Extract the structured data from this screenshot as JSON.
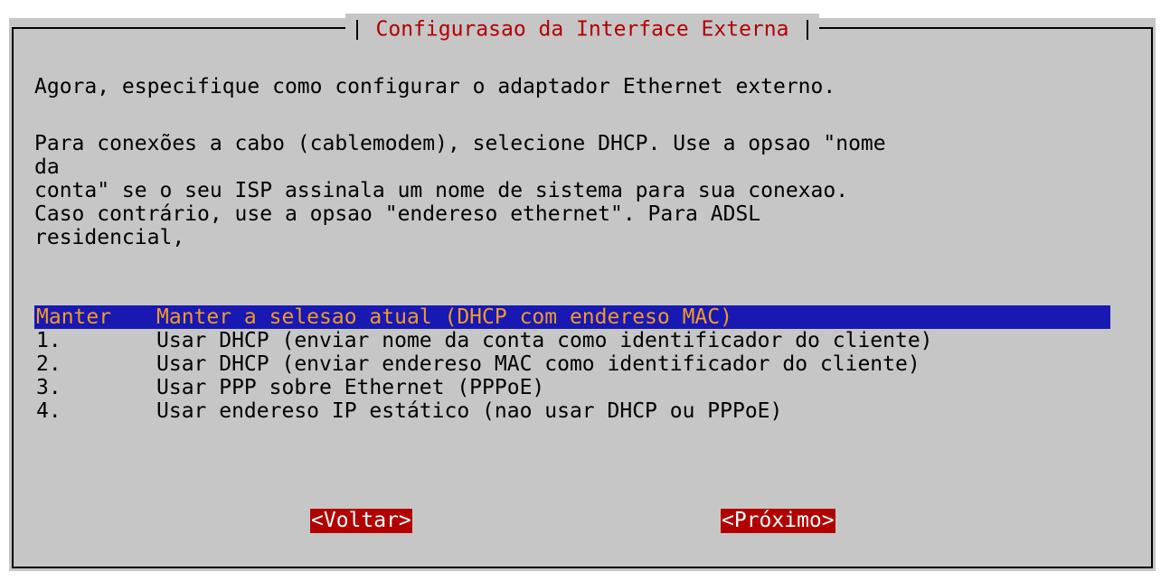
{
  "dialog": {
    "title": "Configurasao da Interface Externa",
    "intro": "Agora, especifique como configurar o adaptador Ethernet externo.",
    "paragraph_lines": [
      "Para conexões a cabo (cablemodem), selecione DHCP. Use a opsao \"nome",
      "da",
      "conta\" se o seu ISP assinala um nome de sistema para sua conexao.",
      "Caso contrário, use a opsao \"endereso ethernet\". Para ADSL",
      "residencial,"
    ],
    "menu": {
      "items": [
        {
          "tag": "Manter",
          "label": "Manter a selesao atual (DHCP com endereso MAC)",
          "selected": true
        },
        {
          "tag": "1.",
          "label": "Usar DHCP (enviar nome da conta como identificador do cliente)"
        },
        {
          "tag": "2.",
          "label": "Usar DHCP (enviar endereso MAC como identificador do cliente)"
        },
        {
          "tag": "3.",
          "label": "Usar PPP sobre Ethernet (PPPoE)"
        },
        {
          "tag": "4.",
          "label": "Usar endereso IP estático (nao usar DHCP ou PPPoE)"
        }
      ]
    },
    "buttons": {
      "back_label": "<Voltar>",
      "next_label": "<Próximo>"
    }
  },
  "colors": {
    "dialog_bg": "#c6c6c6",
    "title_text": "#b20000",
    "selection_bg": "#1818b2",
    "selection_text": "#ef9a2a",
    "button_bg": "#b20000",
    "button_text": "#ffffff"
  }
}
